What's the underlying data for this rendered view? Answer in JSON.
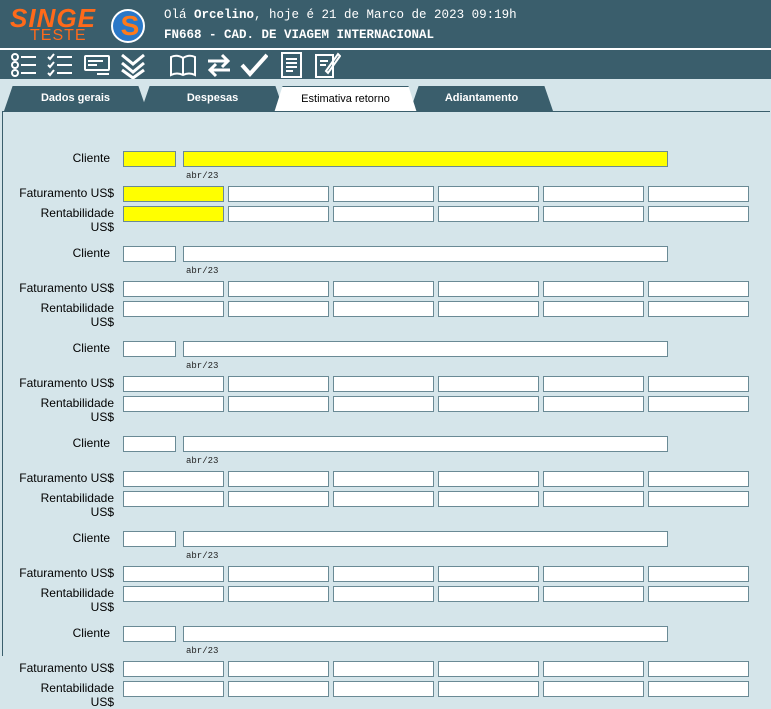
{
  "header": {
    "logo_text": "SINGE",
    "logo_sub": "TESTE",
    "greeting_prefix": "Olá ",
    "user": "Orcelino",
    "greeting_suffix": ", hoje é 21 de Marco de 2023 09:19h",
    "screen_title": "FN668 - CAD. DE VIAGEM INTERNACIONAL"
  },
  "toolbar": {
    "icons": [
      "list-icon",
      "checklist-icon",
      "card-icon",
      "double-chevron-down-icon",
      "book-icon",
      "refresh-icon",
      "checkmark-icon",
      "document-icon",
      "edit-document-icon"
    ]
  },
  "tabs": [
    {
      "label": "Dados gerais"
    },
    {
      "label": "Despesas"
    },
    {
      "label": "Estimativa retorno",
      "active": true
    },
    {
      "label": "Adiantamento"
    }
  ],
  "labels": {
    "cliente": "Cliente",
    "faturamento": "Faturamento US$",
    "rentabilidade_1": "Rentabilidade",
    "rentabilidade_2": "US$",
    "period": "abr/23"
  },
  "colors": {
    "header_bg": "#3a5e6c",
    "panel_bg": "#d5e5ea",
    "required_field": "#ffff00",
    "logo_orange": "#ff6a1a"
  },
  "blocks": [
    {
      "required": true
    },
    {
      "required": false
    },
    {
      "required": false
    },
    {
      "required": false
    },
    {
      "required": false
    },
    {
      "required": false
    }
  ]
}
